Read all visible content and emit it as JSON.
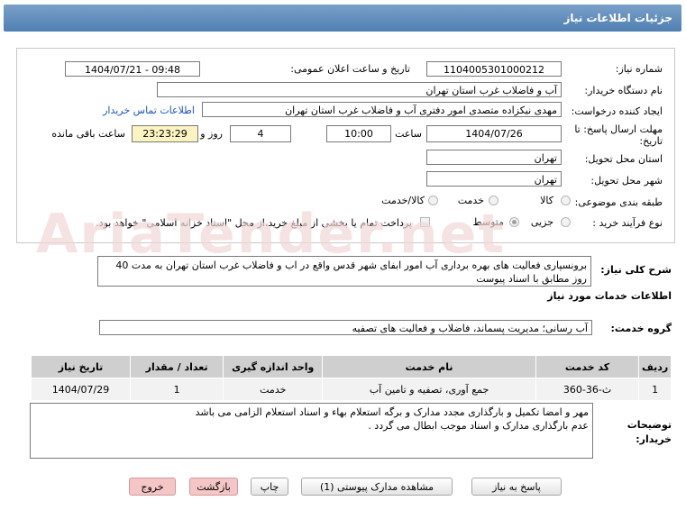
{
  "header": {
    "title": "جزئیات اطلاعات نیاز"
  },
  "form": {
    "need_number_label": "شماره نیاز:",
    "need_number": "1104005301000212",
    "announce_label": "تاریخ و ساعت اعلان عمومی:",
    "announce_value": "1404/07/21 - 09:48",
    "buyer_org_label": "نام دستگاه خریدار:",
    "buyer_org": "آب و فاضلاب غرب استان تهران",
    "creator_label": "ایجاد کننده درخواست:",
    "creator": "مهدی نیکزاده متصدی امور دفتری آب و فاضلاب غرب استان تهران",
    "contact_link": "اطلاعات تماس خریدار",
    "deadline_label": "مهلت ارسال پاسخ: تا تاریخ:",
    "deadline_date": "1404/07/26",
    "time_label": "ساعت",
    "deadline_time": "10:00",
    "days_value": "4",
    "days_label": "روز و",
    "remaining_time": "23:23:29",
    "remaining_label": "ساعت باقی مانده",
    "province_label": "استان محل تحویل:",
    "province": "تهران",
    "city_label": "شهر محل تحویل:",
    "city": "تهران",
    "category_label": "طبقه بندی موضوعی:",
    "category_options": [
      "کالا",
      "خدمت",
      "کالا/خدمت"
    ],
    "process_label": "نوع فرآیند خرید :",
    "process_options": [
      "جزیی",
      "متوسط"
    ],
    "payment_note": "پرداخت تمام یا بخشی از مبلغ خرید،از محل \"اسناد خزانه اسلامی\" خواهد بود."
  },
  "description": {
    "label": "شرح کلی نیاز:",
    "text": "برونسپاری فعالیت های بهره برداری آب امور ابفای شهر قدس واقع در اب و فاضلاب غرب استان تهران  به مدت 40 روز مطابق با اسناد پیوست"
  },
  "services": {
    "section_title": "اطلاعات خدمات مورد نیاز",
    "group_label": "گروه خدمت:",
    "group_value": "آب رسانی؛ مدیریت پسماند، فاضلاب و فعالیت های تصفیه",
    "columns": [
      "ردیف",
      "کد خدمت",
      "نام خدمت",
      "واحد اندازه گیری",
      "تعداد / مقدار",
      "تاریخ نیاز"
    ],
    "rows": [
      [
        "1",
        "ث-36-360",
        "جمع آوری، تصفیه و تامین آب",
        "خدمت",
        "1",
        "1404/07/29"
      ]
    ]
  },
  "notes": {
    "label": "توضیحات خریدار:",
    "line1": "مهر و امضا تکمیل و بارگذاری مجدد مدارک و برگه استعلام بهاء و اسناد استعلام الزامی می باشد",
    "line2": "عدم بارگذاری مدارک و اسناد موجب ابطال می گردد ."
  },
  "buttons": {
    "reply": "پاسخ به نیاز",
    "attachments": "مشاهده مدارک پیوستی (1)",
    "print": "چاپ",
    "back": "بازگشت",
    "exit": "خروج"
  }
}
